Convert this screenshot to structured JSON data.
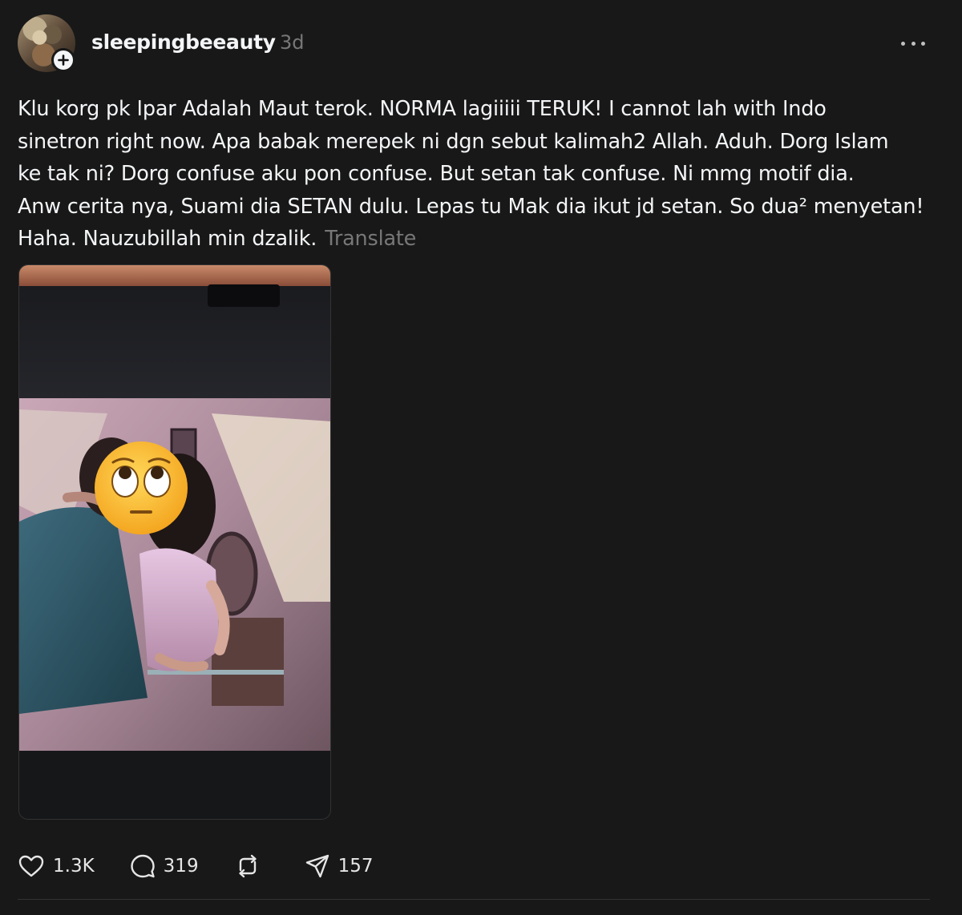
{
  "post": {
    "username": "sleepingbeeauty",
    "timestamp": "3d",
    "text_lines": [
      "Klu korg pk Ipar Adalah Maut terok. NORMA lagiiiii TERUK! I cannot lah with Indo",
      "sinetron right now. Apa babak merepek ni dgn sebut kalimah2 Allah. Aduh. Dorg Islam",
      "ke tak ni? Dorg confuse aku pon confuse. But setan tak confuse. Ni mmg motif dia.",
      "Anw cerita nya, Suami dia SETAN dulu. Lepas tu Mak dia ikut jd setan. So dua² menyetan!",
      "Haha. Nauzubillah min dzalik."
    ],
    "translate_label": "Translate",
    "media_emoji": "🙄",
    "actions": {
      "likes": "1.3K",
      "comments": "319",
      "shares": "157"
    },
    "icons": [
      "heart-icon",
      "comment-icon",
      "repost-icon",
      "share-icon",
      "more-icon",
      "plus-icon"
    ]
  }
}
